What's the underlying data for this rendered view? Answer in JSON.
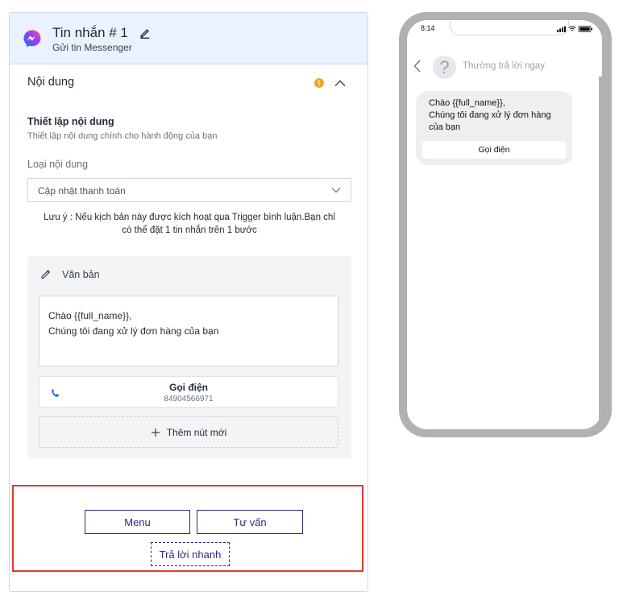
{
  "header": {
    "title": "Tin nhắn # 1",
    "subtitle": "Gửi tin Messenger"
  },
  "section": {
    "title": "Nội dung",
    "warning_glyph": "!"
  },
  "setup": {
    "title": "Thiết lập nội dung",
    "description": "Thiết lập nội dung chính cho hành động của bạn"
  },
  "content_type": {
    "label": "Loại nội dung",
    "selected": "Cập nhật thanh toán"
  },
  "note": {
    "line1": "Lưu ý : Nếu kịch bản này được kích hoạt qua Trigger bình luận.Bạn chỉ",
    "line2": "có thể đặt 1 tin nhắn trên 1 bước"
  },
  "text_block": {
    "label": "Văn bản",
    "lines": [
      "Chào {{full_name}},",
      "Chúng tôi đang xử lý đơn hàng của bạn"
    ],
    "call_button": {
      "label": "Gọi điện",
      "number": "84904566971"
    },
    "add_button_label": "Thêm nút mới"
  },
  "quick_buttons": {
    "menu": "Menu",
    "tu_van": "Tư vấn",
    "quick_reply": "Trả lời nhanh"
  },
  "preview": {
    "time": "8:14",
    "avatar_glyph": "?",
    "reply_status": "Thường trả lời ngay",
    "bubble_lines": [
      "Chào {{full_name}},",
      "Chúng tôi đang xử lý đơn hàng",
      "của bạn"
    ],
    "bubble_button": "Gọi điện"
  },
  "colors": {
    "accent": "#2c2a84",
    "highlight_border": "#e03a2b",
    "warning": "#f5a623",
    "header_bg": "#eaf3fd",
    "phone_frame": "#b1b1b1"
  }
}
